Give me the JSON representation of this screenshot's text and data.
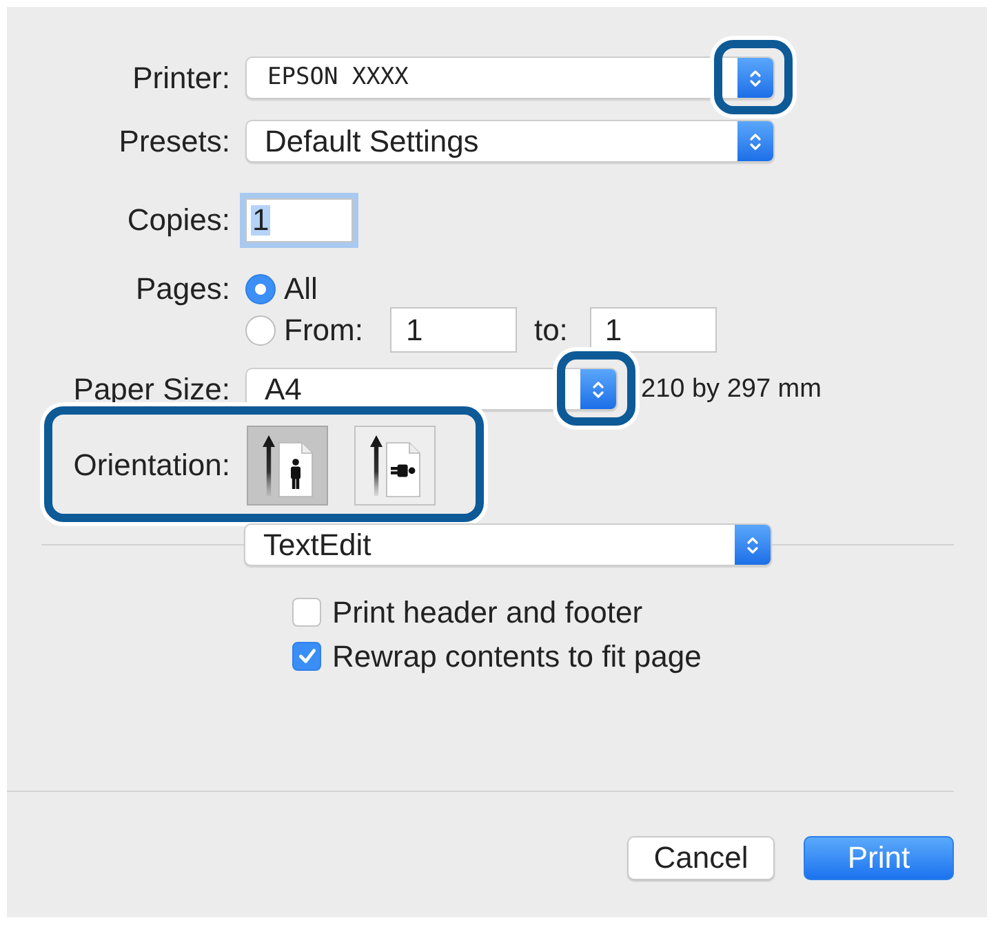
{
  "printer": {
    "label": "Printer:",
    "value": "EPSON XXXX",
    "highlighted": true
  },
  "presets": {
    "label": "Presets:",
    "value": "Default Settings",
    "highlighted": false
  },
  "copies": {
    "label": "Copies:",
    "value": "1",
    "focused": true
  },
  "pages": {
    "label": "Pages:",
    "options": [
      {
        "kind": "all",
        "label": "All",
        "selected": true
      },
      {
        "kind": "range",
        "label": "From:",
        "selected": false,
        "from": "1",
        "to_label": "to:",
        "to": "1"
      }
    ]
  },
  "paper_size": {
    "label": "Paper Size:",
    "value": "A4",
    "highlighted": true,
    "dimensions": "210 by 297 mm"
  },
  "orientation": {
    "label": "Orientation:",
    "highlighted": true,
    "options": [
      {
        "kind": "portrait",
        "selected": true
      },
      {
        "kind": "landscape",
        "selected": false
      }
    ]
  },
  "app_settings": {
    "value": "TextEdit",
    "highlighted": false
  },
  "checkboxes": [
    {
      "label": "Print header and footer",
      "checked": false
    },
    {
      "label": "Rewrap contents to fit page",
      "checked": true
    }
  ],
  "buttons": [
    {
      "label": "Cancel",
      "kind": "cancel"
    },
    {
      "label": "Print",
      "kind": "primary"
    }
  ]
}
